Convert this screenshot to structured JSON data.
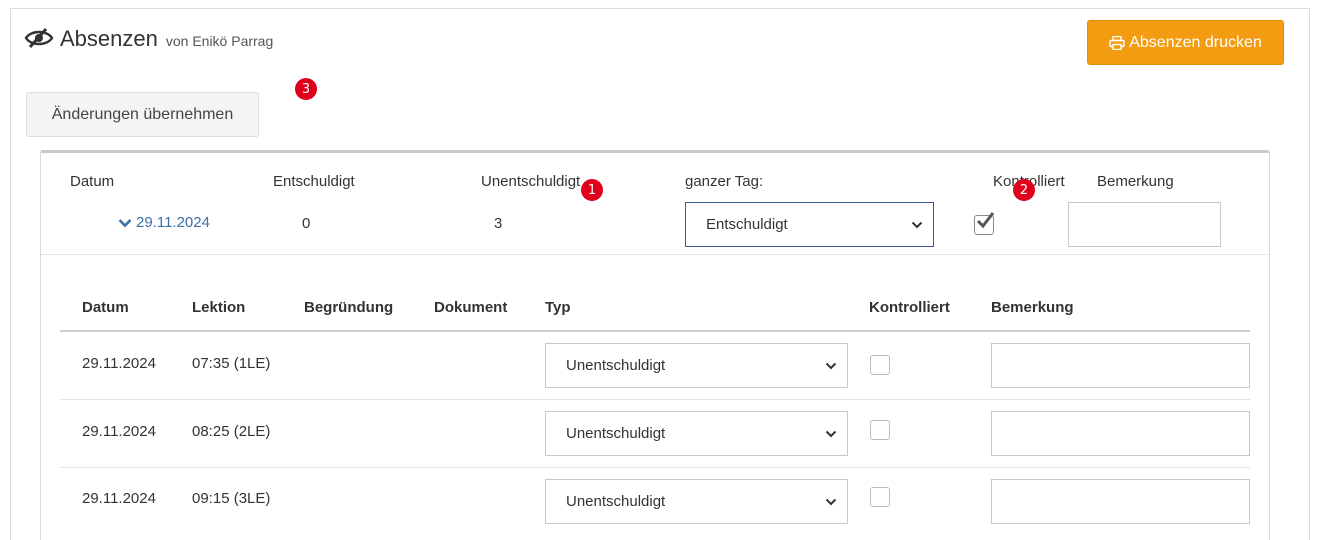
{
  "header": {
    "title": "Absenzen",
    "subtitle": "von Enikö Parrag",
    "print_button": "Absenzen drucken",
    "apply_button": "Änderungen übernehmen"
  },
  "badges": [
    "1",
    "2",
    "3"
  ],
  "summary": {
    "headers": {
      "datum": "Datum",
      "entschuldigt": "Entschuldigt",
      "unentschuldigt": "Unentschuldigt",
      "ganzer_tag": "ganzer Tag:",
      "kontrolliert": "Kontrolliert",
      "bemerkung": "Bemerkung"
    },
    "date": "29.11.2024",
    "entschuldigt": "0",
    "unentschuldigt": "3",
    "ganzer_tag_value": "Entschuldigt",
    "kontrolliert": true,
    "bemerkung": ""
  },
  "detail": {
    "headers": {
      "datum": "Datum",
      "lektion": "Lektion",
      "begruendung": "Begründung",
      "dokument": "Dokument",
      "typ": "Typ",
      "kontrolliert": "Kontrolliert",
      "bemerkung": "Bemerkung"
    },
    "rows": [
      {
        "datum": "29.11.2024",
        "lektion": "07:35 (1LE)",
        "typ": "Unentschuldigt",
        "kontrolliert": false,
        "bemerkung": ""
      },
      {
        "datum": "29.11.2024",
        "lektion": "08:25 (2LE)",
        "typ": "Unentschuldigt",
        "kontrolliert": false,
        "bemerkung": ""
      },
      {
        "datum": "29.11.2024",
        "lektion": "09:15 (3LE)",
        "typ": "Unentschuldigt",
        "kontrolliert": false,
        "bemerkung": ""
      }
    ]
  },
  "colors": {
    "accent": "#f39c12",
    "link": "#3c6fa8",
    "badge": "#e0001b"
  }
}
